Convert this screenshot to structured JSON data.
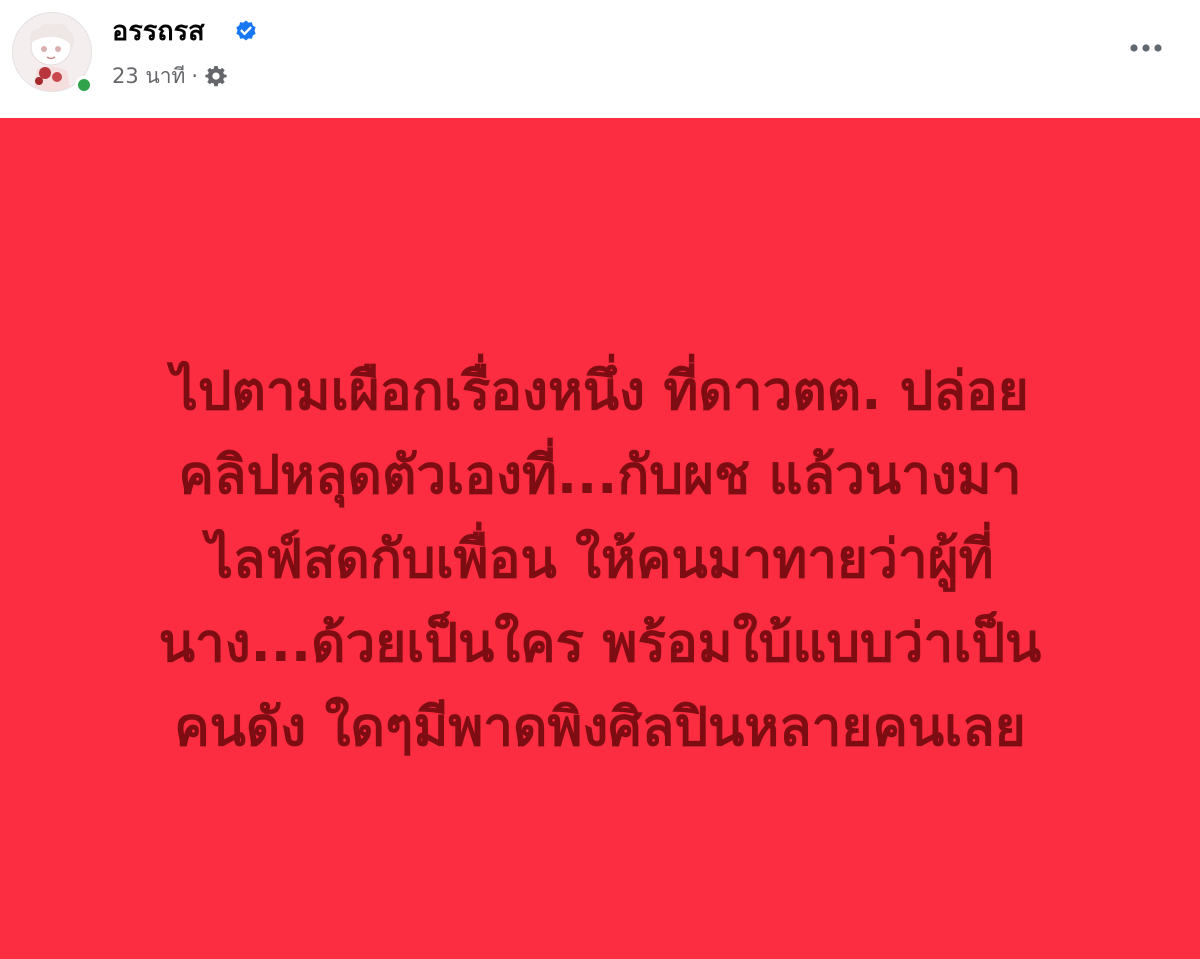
{
  "post": {
    "author": {
      "name": "อรรถรส",
      "verified": true,
      "avatar_icon": "avatar-image",
      "online_status_color": "#31a24c"
    },
    "meta": {
      "time": "23 นาที",
      "separator": "·",
      "audience_icon": "gear-icon"
    },
    "more_icon": "more-options-icon",
    "background_color": "#fd2d41",
    "text_color": "#7d0d12",
    "text_lines": [
      "ไปตามเผือกเรื่องหนึ่ง ที่ดาวตต. ปล่อย",
      "คลิปหลุดตัวเองที่...กับผช แล้วนางมา",
      "ไลฟ์สดกับเพื่อน ให้คนมาทายว่าผู้ที่",
      "นาง...ด้วยเป็นใคร พร้อมใบ้แบบว่าเป็น",
      "คนดัง ใดๆมีพาดพิงศิลปินหลายคนเลย"
    ]
  }
}
